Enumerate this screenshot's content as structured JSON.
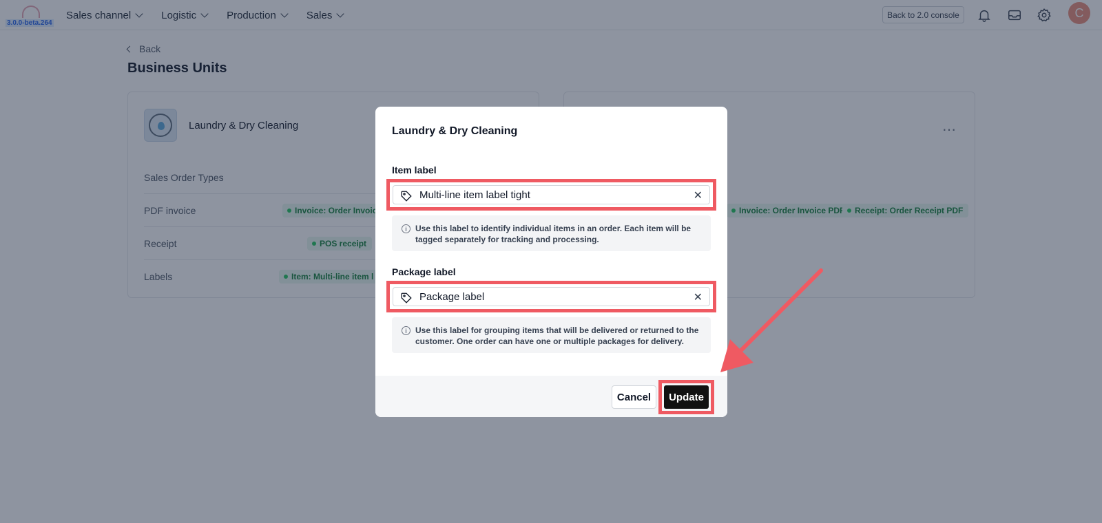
{
  "app": {
    "version": "3.0.0-beta.264",
    "nav": [
      {
        "label": "Sales channel"
      },
      {
        "label": "Logistic"
      },
      {
        "label": "Production"
      },
      {
        "label": "Sales"
      }
    ],
    "console_button": "Back to 2.0 console",
    "avatar_initial": "C"
  },
  "page": {
    "back_label": "Back",
    "title": "Business Units"
  },
  "business_unit": {
    "name": "Laundry & Dry Cleaning",
    "rows": [
      {
        "label": "Sales Order Types"
      },
      {
        "label": "PDF invoice",
        "tag": "Invoice: Order Invoic"
      },
      {
        "label": "Receipt",
        "tag": "POS receipt"
      },
      {
        "label": "Labels",
        "tag": "Item: Multi-line item l"
      }
    ],
    "right_card_tags": {
      "invoice": "Invoice: Order Invoice PDF",
      "receipt": "Receipt: Order Receipt PDF"
    }
  },
  "modal": {
    "title": "Laundry & Dry Cleaning",
    "item_label": {
      "label": "Item label",
      "value": "Multi-line item label tight",
      "hint": "Use this label to identify individual items in an order. Each item will be tagged separately for tracking and processing."
    },
    "package_label": {
      "label": "Package label",
      "value": "Package label",
      "hint": "Use this label for grouping items that will be delivered or returned to the customer. One order can have one or multiple packages for delivery."
    },
    "cancel_label": "Cancel",
    "update_label": "Update"
  },
  "colors": {
    "highlight": "#ef5a62",
    "tag_green": "#15803d",
    "overlay": "#1e2942"
  },
  "icons": [
    "bell-icon",
    "inbox-icon",
    "gear-icon",
    "tag-icon",
    "close-icon",
    "info-icon",
    "chevron-down-icon",
    "chevron-left-icon"
  ]
}
